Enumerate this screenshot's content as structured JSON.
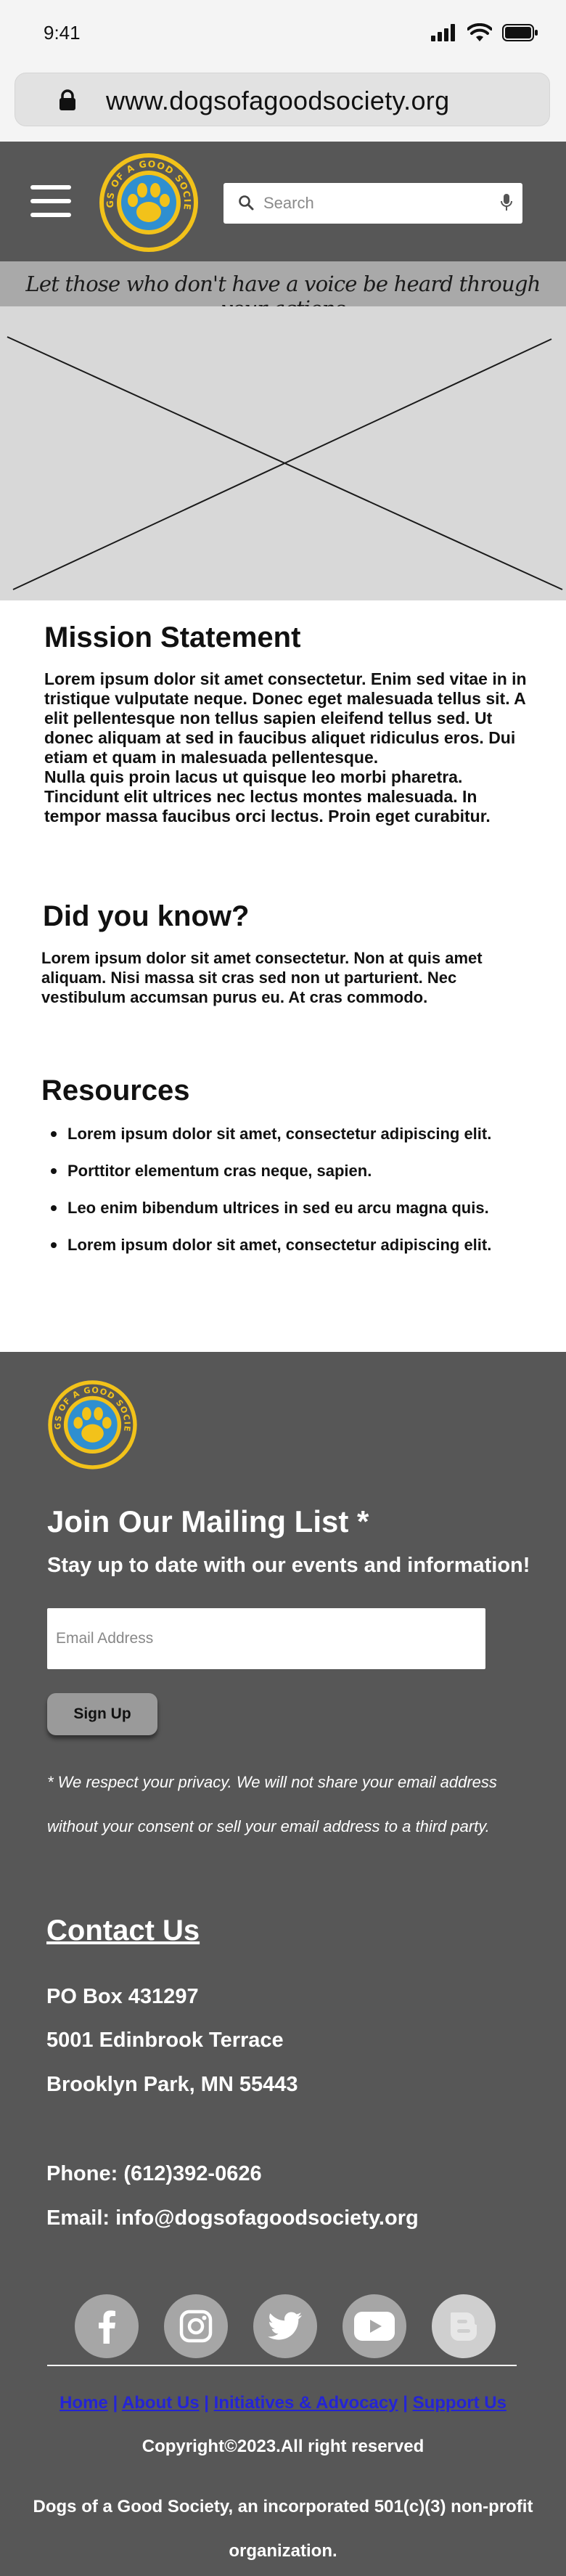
{
  "status_bar": {
    "time": "9:41"
  },
  "browser": {
    "url": "www.dogsofagoodsociety.org"
  },
  "header": {
    "logo_text": "DOGS OF A GOOD SOCIETY",
    "search_placeholder": "Search"
  },
  "tagline": "Let those who don't have a voice be heard through your actions",
  "mission": {
    "title": "Mission Statement",
    "paragraph1": "Lorem ipsum dolor sit amet consectetur. Enim sed vitae in in tristique vulputate neque. Donec eget malesuada tellus sit. A elit pellentesque non tellus sapien eleifend tellus sed. Ut donec aliquam at sed in faucibus aliquet ridiculus eros. Dui etiam et quam in malesuada pellentesque.",
    "paragraph2": "Nulla quis proin lacus ut quisque leo morbi pharetra. Tincidunt elit ultrices nec lectus montes malesuada. In tempor massa faucibus orci lectus. Proin eget curabitur."
  },
  "did_you_know": {
    "title": "Did you know?",
    "body": "Lorem ipsum dolor sit amet consectetur. Non at quis amet aliquam. Nisi massa sit cras sed non ut parturient. Nec vestibulum accumsan purus eu. At cras commodo."
  },
  "resources": {
    "title": "Resources",
    "items": [
      "Lorem ipsum dolor sit amet, consectetur adipiscing elit.",
      "Porttitor elementum cras neque, sapien.",
      "Leo enim bibendum ultrices in sed eu arcu magna quis.",
      "Lorem ipsum dolor sit amet, consectetur adipiscing elit."
    ]
  },
  "footer": {
    "join_title": "Join Our Mailing List *",
    "join_subtitle": "Stay up to date with our events and information!",
    "email_placeholder": "Email Address",
    "signup_label": "Sign Up",
    "privacy_note": "* We respect your privacy. We will not share your email address without your consent or sell your email address to a third party.",
    "contact_title": "Contact Us",
    "address_line1": "PO Box 431297",
    "address_line2": "5001 Edinbrook Terrace",
    "address_line3": "Brooklyn Park, MN 55443",
    "phone": "Phone: (612)392-0626",
    "email": "Email: info@dogsofagoodsociety.org",
    "social_icons": [
      "facebook-icon",
      "instagram-icon",
      "twitter-icon",
      "youtube-icon",
      "blogger-icon"
    ],
    "links": [
      "Home",
      "About Us",
      "Initiatives & Advocacy",
      "Support Us"
    ],
    "separator": "|",
    "copyright": "Copyright©2023.All right reserved",
    "org_line": "Dogs of a Good Society, an incorporated 501(c)(3) non-profit organization."
  },
  "colors": {
    "header_bg": "#575757",
    "tagline_bg": "#a9a9a9",
    "logo_yellow": "#f2c21a",
    "logo_blue": "#2f8fd0",
    "link_blue": "#2424d6"
  }
}
